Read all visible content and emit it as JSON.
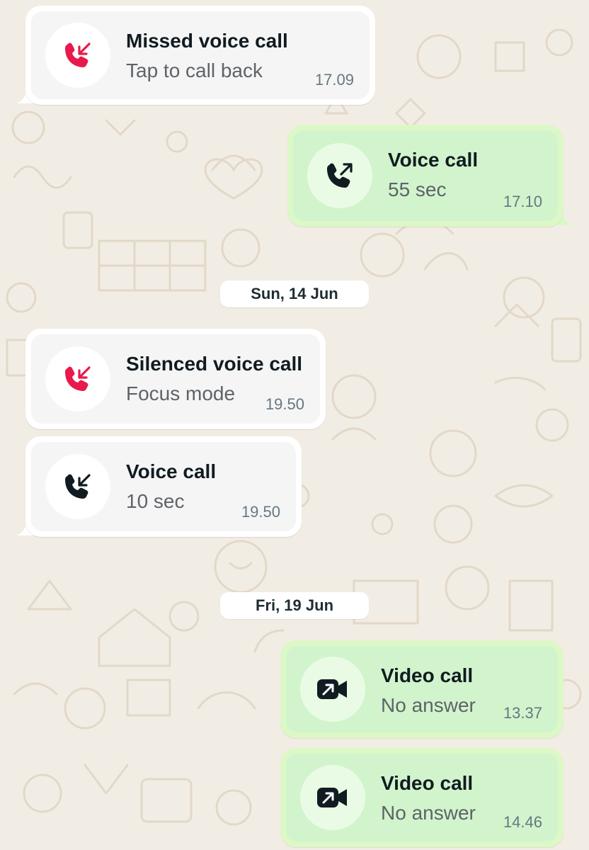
{
  "colors": {
    "wallpaper": "#f2ede4",
    "doodle": "#e3d8c8",
    "incoming_bubble": "#ffffff",
    "outgoing_bubble": "#dcf8c6",
    "missed_call_red": "#e8194c",
    "icon_dark": "#111b21"
  },
  "date_separators": [
    {
      "label": "Sun, 14 Jun"
    },
    {
      "label": "Fri, 19 Jun"
    }
  ],
  "messages": [
    {
      "direction": "incoming",
      "icon": "missed-call-icon",
      "title": "Missed voice call",
      "subtitle": "Tap to call back",
      "time": "17.09"
    },
    {
      "direction": "outgoing",
      "icon": "outgoing-call-icon",
      "title": "Voice call",
      "subtitle": "55 sec",
      "time": "17.10"
    },
    {
      "direction": "incoming",
      "icon": "silenced-call-icon",
      "title": "Silenced voice call",
      "subtitle": "Focus mode",
      "time": "19.50"
    },
    {
      "direction": "incoming",
      "icon": "incoming-call-icon",
      "title": "Voice call",
      "subtitle": "10 sec",
      "time": "19.50"
    },
    {
      "direction": "outgoing",
      "icon": "outgoing-video-call-icon",
      "title": "Video call",
      "subtitle": "No answer",
      "time": "13.37"
    },
    {
      "direction": "outgoing",
      "icon": "outgoing-video-call-icon",
      "title": "Video call",
      "subtitle": "No answer",
      "time": "14.46"
    }
  ]
}
